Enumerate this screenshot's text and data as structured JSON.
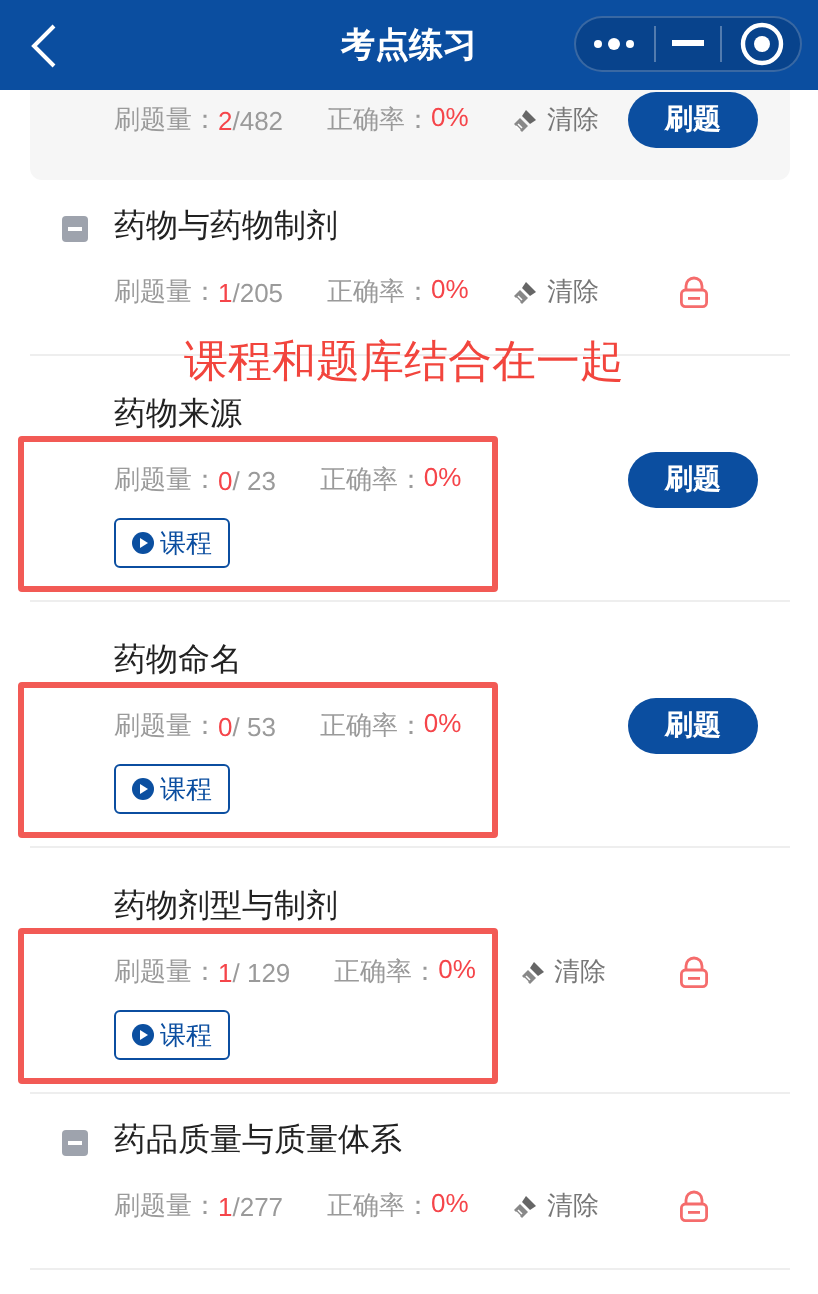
{
  "header": {
    "title": "考点练习"
  },
  "annotation_note": "课程和题库结合在一起",
  "items": [
    {
      "kind": "card",
      "count_label": "刷题量：",
      "count": "2",
      "total": "/482",
      "accuracy_label": "正确率：",
      "accuracy": "0%",
      "clear_label": "清除",
      "action": "刷题"
    },
    {
      "kind": "section",
      "title": "药物与药物制剂",
      "expanded": true,
      "count_label": "刷题量：",
      "count": "1",
      "total": "/205",
      "accuracy_label": "正确率：",
      "accuracy": "0%",
      "clear_label": "清除",
      "locked": true
    },
    {
      "kind": "topic",
      "title": "药物来源",
      "count_label": "刷题量：",
      "count": "0",
      "total": "/ 23",
      "accuracy_label": "正确率：",
      "accuracy": "0%",
      "action": "刷题",
      "course": "课程",
      "annotated": true
    },
    {
      "kind": "topic",
      "title": "药物命名",
      "count_label": "刷题量：",
      "count": "0",
      "total": "/ 53",
      "accuracy_label": "正确率：",
      "accuracy": "0%",
      "action": "刷题",
      "course": "课程",
      "annotated": true
    },
    {
      "kind": "topic",
      "title": "药物剂型与制剂",
      "count_label": "刷题量：",
      "count": "1",
      "total": "/ 129",
      "accuracy_label": "正确率：",
      "accuracy": "0%",
      "clear_label": "清除",
      "course": "课程",
      "locked": true,
      "annotated": true
    },
    {
      "kind": "section",
      "title": "药品质量与质量体系",
      "expanded": true,
      "count_label": "刷题量：",
      "count": "1",
      "total": "/277",
      "accuracy_label": "正确率：",
      "accuracy": "0%",
      "clear_label": "清除",
      "locked": true
    }
  ]
}
